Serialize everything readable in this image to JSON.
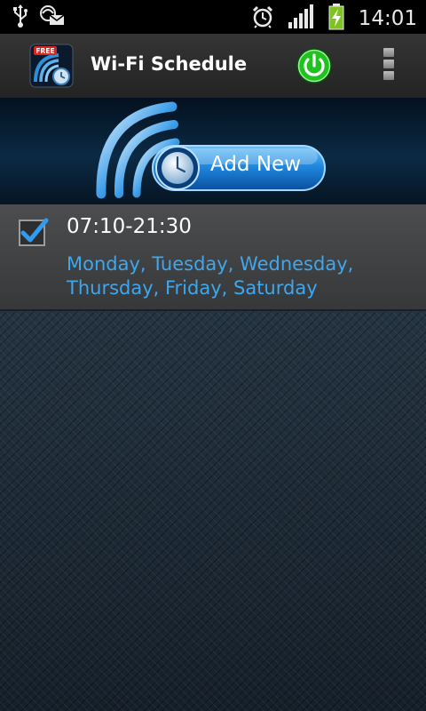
{
  "status_bar": {
    "time": "14:01",
    "icons": [
      "usb-icon",
      "notification-icon",
      "alarm-icon",
      "signal-icon",
      "battery-charging-icon"
    ]
  },
  "action_bar": {
    "app_icon_badge": "FREE",
    "title": "Wi-Fi Schedule",
    "power_color": "#1fc21f"
  },
  "banner": {
    "add_new_label": "Add New"
  },
  "schedules": [
    {
      "checked": true,
      "time_range": "07:10-21:30",
      "days": "Monday, Tuesday, Wednesday, Thursday, Friday, Saturday"
    }
  ],
  "colors": {
    "accent_blue": "#3fa7ee",
    "power_green": "#1fc21f"
  }
}
